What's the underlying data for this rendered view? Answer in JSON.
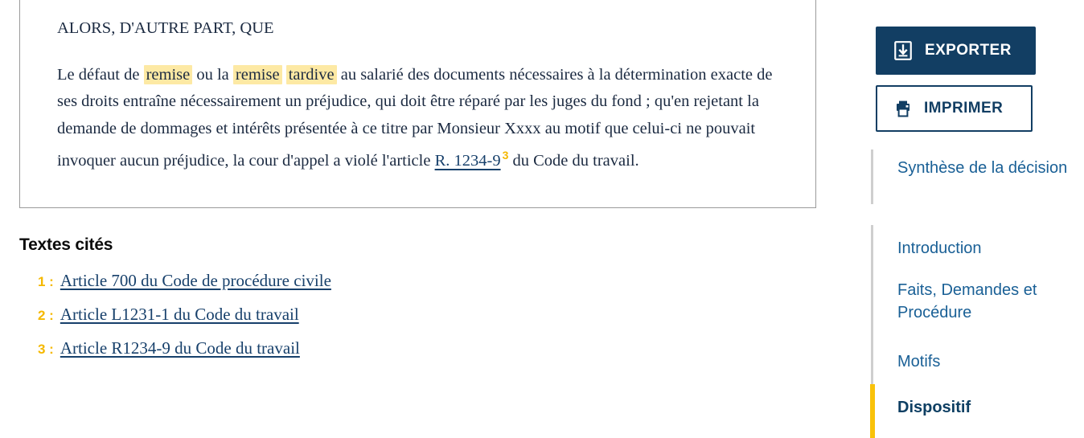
{
  "document": {
    "paragraphs": [
      {
        "id": "alors",
        "text": "ALORS, D'AUTRE PART, QUE"
      },
      {
        "id": "body",
        "segments": [
          {
            "type": "text",
            "value": "Le défaut de "
          },
          {
            "type": "highlight",
            "value": "remise"
          },
          {
            "type": "text",
            "value": " ou la "
          },
          {
            "type": "highlight",
            "value": "remise"
          },
          {
            "type": "text",
            "value": " "
          },
          {
            "type": "highlight",
            "value": "tardive"
          },
          {
            "type": "text",
            "value": " au salarié des documents nécessaires à la détermination exacte de ses droits entraîne nécessairement un préjudice, qui doit être réparé par les juges du fond ; qu'en rejetant la demande de dommages et intérêts présentée à ce titre par Monsieur Xxxx au motif que celui-ci ne pouvait invoquer aucun préjudice, la cour d'appel a violé l'article "
          },
          {
            "type": "link",
            "value": "R. 1234-9"
          },
          {
            "type": "superscript",
            "value": "3"
          },
          {
            "type": "text",
            "value": " du Code du travail."
          }
        ],
        "lead": "Le défaut de ",
        "hl1": "remise",
        "mid1": " ou la ",
        "hl2": "remise",
        "space": " ",
        "hl3": "tardive",
        "tail": " au salarié des documents nécessaires à la détermination exacte de ses droits entraîne nécessairement un préjudice, qui doit être réparé par les juges du fond ; qu'en rejetant la demande de dommages et intérêts présentée à ce titre par Monsieur Xxxx au motif que celui-ci ne pouvait invoquer aucun préjudice, la cour d'appel a violé l'article ",
        "article_link": "R. 1234-9",
        "article_ref": "3",
        "end": " du Code du travail."
      }
    ]
  },
  "cited": {
    "title": "Textes cités",
    "items": [
      {
        "number": "1 :",
        "label": "Article 700 du Code de procédure civile"
      },
      {
        "number": "2 :",
        "label": "Article L1231-1 du Code du travail"
      },
      {
        "number": "3 :",
        "label": "Article R1234-9 du Code du travail"
      }
    ]
  },
  "actions": {
    "export_label": "EXPORTER",
    "export_icon": "download-box-icon",
    "print_label": "IMPRIMER",
    "print_icon": "printer-icon"
  },
  "nav": {
    "items": [
      {
        "label": "Synthèse de la décision",
        "active": false
      },
      {
        "label": "Introduction",
        "active": false
      },
      {
        "label": "Faits, Demandes et Procédure",
        "active": false
      },
      {
        "label": "Motifs",
        "active": false
      },
      {
        "label": "Dispositif",
        "active": true
      }
    ]
  },
  "colors": {
    "brand_navy": "#123e63",
    "accent_yellow": "#f9c20a",
    "highlight_yellow": "#fde9a4",
    "link_blue": "#17406b",
    "nav_blue": "#1a6096",
    "rail_gray": "#cfcfcf",
    "box_border": "#9a9a9a"
  }
}
